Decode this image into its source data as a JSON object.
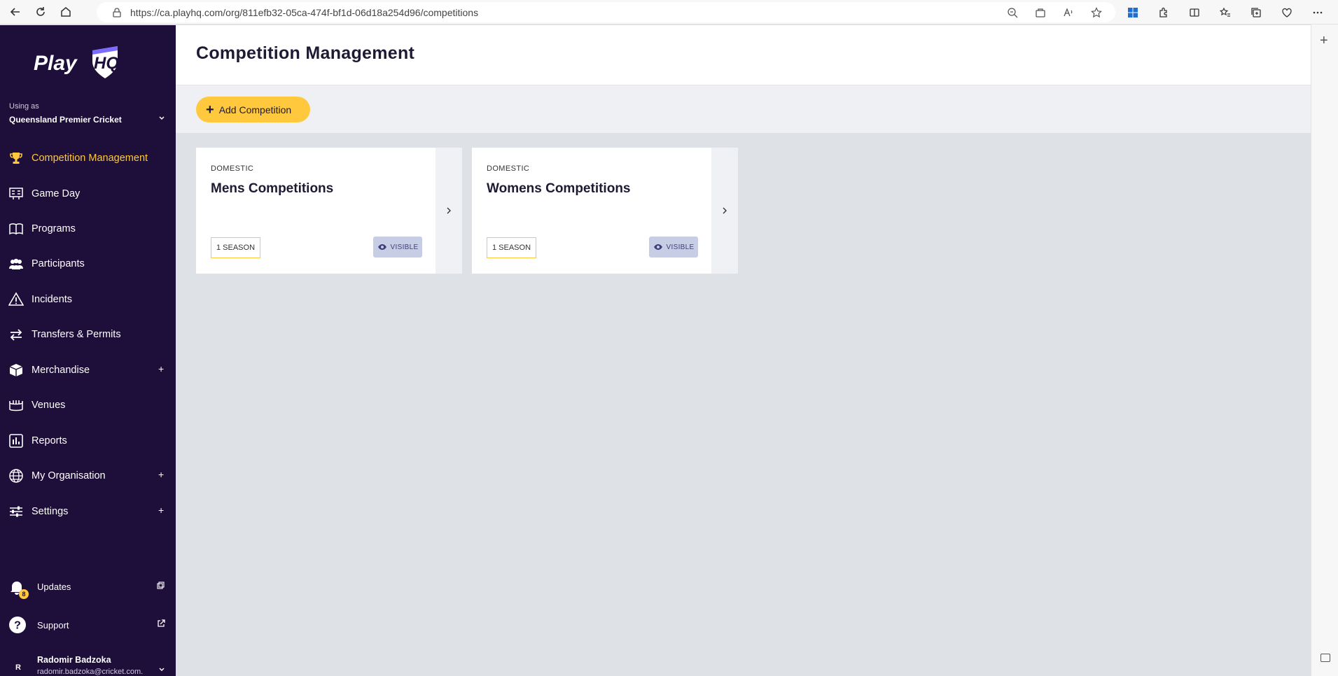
{
  "browser": {
    "url": "https://ca.playhq.com/org/811efb32-05ca-474f-bf1d-06d18a254d96/competitions"
  },
  "sidebar": {
    "logo_text": "PlayHQ",
    "using_as_label": "Using as",
    "org_name": "Queensland Premier Cricket",
    "items": [
      {
        "label": "Competition Management",
        "icon": "trophy-icon",
        "active": true
      },
      {
        "label": "Game Day",
        "icon": "scoreboard-icon"
      },
      {
        "label": "Programs",
        "icon": "book-icon"
      },
      {
        "label": "Participants",
        "icon": "people-icon"
      },
      {
        "label": "Incidents",
        "icon": "warning-icon"
      },
      {
        "label": "Transfers & Permits",
        "icon": "transfer-icon"
      },
      {
        "label": "Merchandise",
        "icon": "box-icon",
        "expandable": true
      },
      {
        "label": "Venues",
        "icon": "stadium-icon"
      },
      {
        "label": "Reports",
        "icon": "chart-icon"
      },
      {
        "label": "My Organisation",
        "icon": "globe-icon",
        "expandable": true
      },
      {
        "label": "Settings",
        "icon": "sliders-icon",
        "expandable": true
      }
    ],
    "updates": {
      "label": "Updates",
      "badge": "8"
    },
    "support": {
      "label": "Support"
    },
    "user": {
      "initial": "R",
      "name": "Radomir Badzoka",
      "email": "radomir.badzoka@cricket.com."
    }
  },
  "header": {
    "title": "Competition Management"
  },
  "toolbar": {
    "add_label": "Add Competition"
  },
  "cards": [
    {
      "type": "DOMESTIC",
      "name": "Mens Competitions",
      "season": "1 SEASON",
      "visibility": "VISIBLE"
    },
    {
      "type": "DOMESTIC",
      "name": "Womens Competitions",
      "season": "1 SEASON",
      "visibility": "VISIBLE"
    }
  ],
  "colors": {
    "sidebar_bg": "#1d0e3a",
    "accent": "#ffc83d",
    "visible_badge": "#c8cde6"
  }
}
